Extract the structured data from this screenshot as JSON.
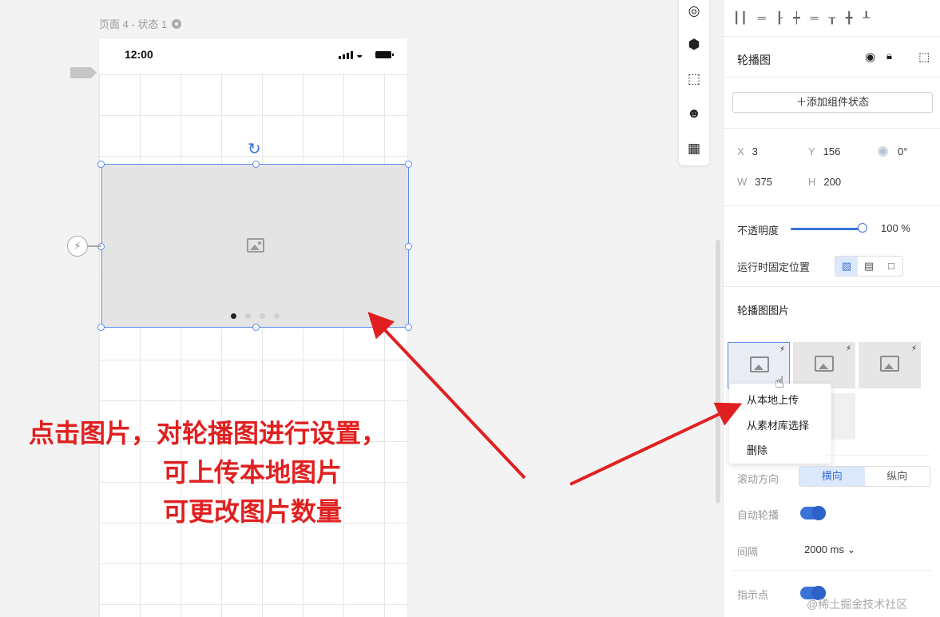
{
  "canvas": {
    "page_label": "页面 4 - 状态 1",
    "status_time": "12:00"
  },
  "annotation": {
    "lines": [
      "点击图片，对轮播图进行设置，",
      "可上传本地图片",
      "可更改图片数量"
    ]
  },
  "toolbar": {
    "icons": [
      "target-icon",
      "cube-icon",
      "frame-icon",
      "emoji-icon",
      "layout-icon"
    ]
  },
  "panel": {
    "component_name": "轮播图",
    "add_state_label": "添加组件状态",
    "x_label": "X",
    "x_value": "3",
    "y_label": "Y",
    "y_value": "156",
    "rotation": "0°",
    "w_label": "W",
    "w_value": "375",
    "h_label": "H",
    "h_value": "200",
    "opacity_label": "不透明度",
    "opacity_value": "100 %",
    "opacity_fraction": 1.0,
    "fixed_label": "运行时固定位置",
    "section_title": "轮播图图片",
    "menu": [
      "从本地上传",
      "从素材库选择",
      "删除"
    ],
    "scroll_label": "滚动方向",
    "dir_options": [
      "横向",
      "纵向"
    ],
    "autoplay_label": "自动轮播",
    "interval_label": "间隔",
    "interval_value": "2000 ms",
    "indicator_label": "指示点"
  },
  "watermark": "@稀土掘金技术社区",
  "colors": {
    "accent": "#3a73d9",
    "annotation": "#e02020",
    "selection": "#5b8def"
  }
}
